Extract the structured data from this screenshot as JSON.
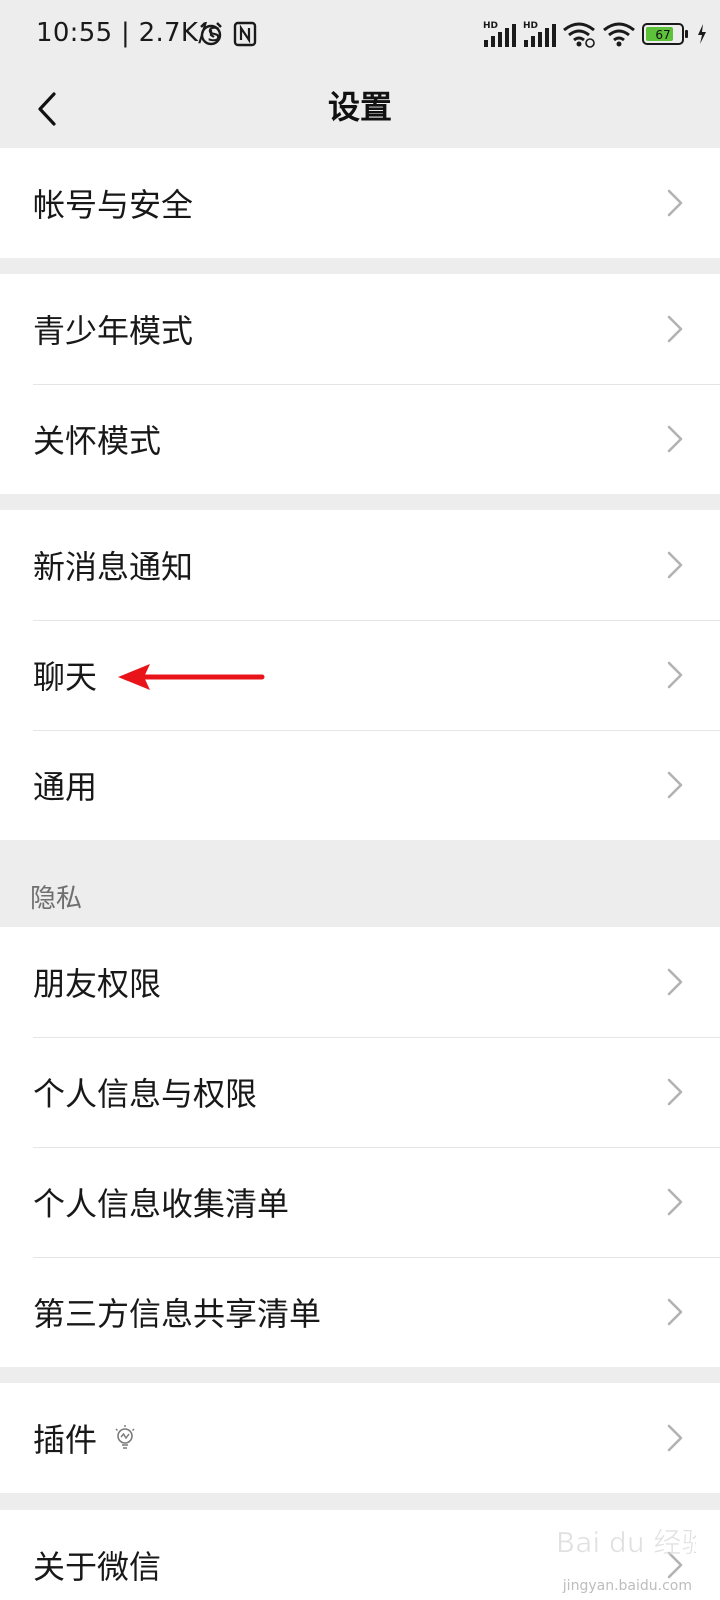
{
  "status_bar": {
    "time": "10:55 | 2.7K/s",
    "battery": "67",
    "signal1": "HD",
    "signal2": "HD"
  },
  "header": {
    "title": "设置"
  },
  "sections": [
    {
      "items": [
        {
          "label": "帐号与安全"
        }
      ]
    },
    {
      "items": [
        {
          "label": "青少年模式"
        },
        {
          "label": "关怀模式"
        }
      ]
    },
    {
      "items": [
        {
          "label": "新消息通知"
        },
        {
          "label": "聊天"
        },
        {
          "label": "通用"
        }
      ]
    },
    {
      "header": "隐私",
      "items": [
        {
          "label": "朋友权限"
        },
        {
          "label": "个人信息与权限"
        },
        {
          "label": "个人信息收集清单"
        },
        {
          "label": "第三方信息共享清单"
        }
      ]
    },
    {
      "items": [
        {
          "label": "插件"
        }
      ]
    },
    {
      "items": [
        {
          "label": "关于微信"
        }
      ]
    }
  ],
  "annotation": {
    "color": "#e8141a",
    "target": "聊天"
  },
  "watermark": {
    "brand": "Bai du 经验",
    "url": "jingyan.baidu.com"
  },
  "colors": {
    "background": "#ededed",
    "card": "#ffffff",
    "divider": "#e5e5e5",
    "battery_fill": "#5dc13a"
  }
}
